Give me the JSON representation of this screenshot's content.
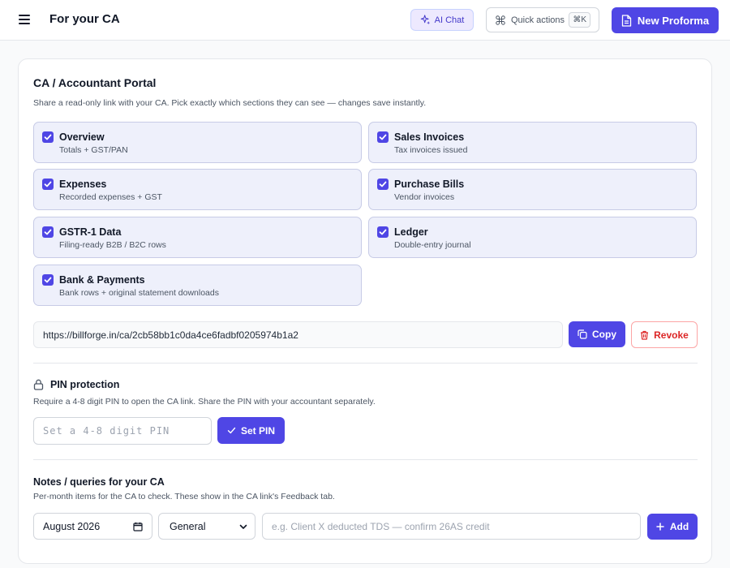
{
  "header": {
    "title": "For your CA",
    "ai_chat_label": "AI Chat",
    "quick_actions_label": "Quick actions",
    "quick_actions_shortcut": "⌘K",
    "new_proforma_label": "New Proforma"
  },
  "portal": {
    "title": "CA / Accountant Portal",
    "description": "Share a read-only link with your CA. Pick exactly which sections they can see — changes save instantly.",
    "sections": [
      {
        "label": "Overview",
        "sub": "Totals + GST/PAN",
        "checked": true
      },
      {
        "label": "Sales Invoices",
        "sub": "Tax invoices issued",
        "checked": true
      },
      {
        "label": "Expenses",
        "sub": "Recorded expenses + GST",
        "checked": true
      },
      {
        "label": "Purchase Bills",
        "sub": "Vendor invoices",
        "checked": true
      },
      {
        "label": "GSTR-1 Data",
        "sub": "Filing-ready B2B / B2C rows",
        "checked": true
      },
      {
        "label": "Ledger",
        "sub": "Double-entry journal",
        "checked": true
      },
      {
        "label": "Bank & Payments",
        "sub": "Bank rows + original statement downloads",
        "checked": true
      }
    ],
    "share_link": "https://billforge.in/ca/2cb58bb1c0da4ce6fadbf0205974b1a2",
    "copy_label": "Copy",
    "revoke_label": "Revoke"
  },
  "pin": {
    "title": "PIN protection",
    "description": "Require a 4-8 digit PIN to open the CA link. Share the PIN with your accountant separately.",
    "placeholder": "Set a 4-8 digit PIN",
    "value": "",
    "button_label": "Set PIN"
  },
  "notes": {
    "title": "Notes / queries for your CA",
    "description": "Per-month items for the CA to check. These show in the CA link's Feedback tab.",
    "month_value": "August 2026",
    "category_value": "General",
    "placeholder": "e.g. Client X deducted TDS — confirm 26AS credit",
    "add_label": "Add"
  },
  "colors": {
    "accent": "#4f46e5",
    "danger": "#dc2626",
    "section_bg": "#eef0fb"
  }
}
